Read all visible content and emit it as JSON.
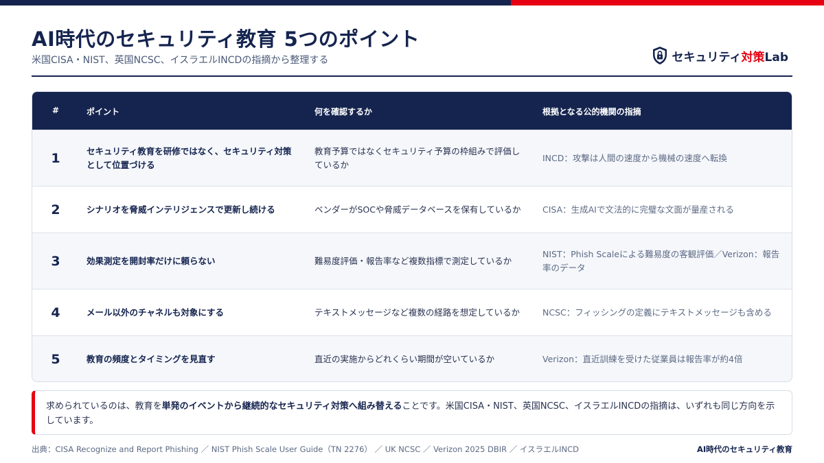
{
  "header": {
    "title": "AI時代のセキュリティ教育 5つのポイント",
    "subtitle": "米国CISA・NIST、英国NCSC、イスラエルINCDの指摘から整理する"
  },
  "logo": {
    "brand_part1": "セキュリティ",
    "brand_part2": "対策",
    "brand_part3": "Lab",
    "icon": "shield-lock-icon"
  },
  "table": {
    "headers": {
      "num": "#",
      "point": "ポイント",
      "check": "何を確認するか",
      "basis": "根拠となる公的機関の指摘"
    },
    "rows": [
      {
        "num": "1",
        "point": "セキュリティ教育を研修ではなく、セキュリティ対策として位置づける",
        "check": "教育予算ではなくセキュリティ予算の枠組みで評価しているか",
        "basis": "INCD：攻撃は人間の速度から機械の速度へ転換"
      },
      {
        "num": "2",
        "point": "シナリオを脅威インテリジェンスで更新し続ける",
        "check": "ベンダーがSOCや脅威データベースを保有しているか",
        "basis": "CISA：生成AIで文法的に完璧な文面が量産される"
      },
      {
        "num": "3",
        "point": "効果測定を開封率だけに頼らない",
        "check": "難易度評価・報告率など複数指標で測定しているか",
        "basis": "NIST：Phish Scaleによる難易度の客観評価／Verizon：報告率のデータ"
      },
      {
        "num": "4",
        "point": "メール以外のチャネルも対象にする",
        "check": "テキストメッセージなど複数の経路を想定しているか",
        "basis": "NCSC：フィッシングの定義にテキストメッセージも含める"
      },
      {
        "num": "5",
        "point": "教育の頻度とタイミングを見直す",
        "check": "直近の実施からどれくらい期間が空いているか",
        "basis": "Verizon：直近訓練を受けた従業員は報告率が約4倍"
      }
    ]
  },
  "summary": {
    "before": "求められているのは、教育を",
    "emphasis": "単発のイベントから継続的なセキュリティ対策へ組み替える",
    "after": "ことです。米国CISA・NIST、英国NCSC、イスラエルINCDの指摘は、いずれも同じ方向を示しています。"
  },
  "footer": {
    "source": "出典：CISA Recognize and Report Phishing ／ NIST Phish Scale User Guide（TN 2276） ／ UK NCSC ／ Verizon 2025 DBIR ／ イスラエルINCD",
    "right": "AI時代のセキュリティ教育"
  },
  "colors": {
    "navy": "#15244f",
    "red": "#e60012",
    "row_alt": "#f5f7fb"
  }
}
